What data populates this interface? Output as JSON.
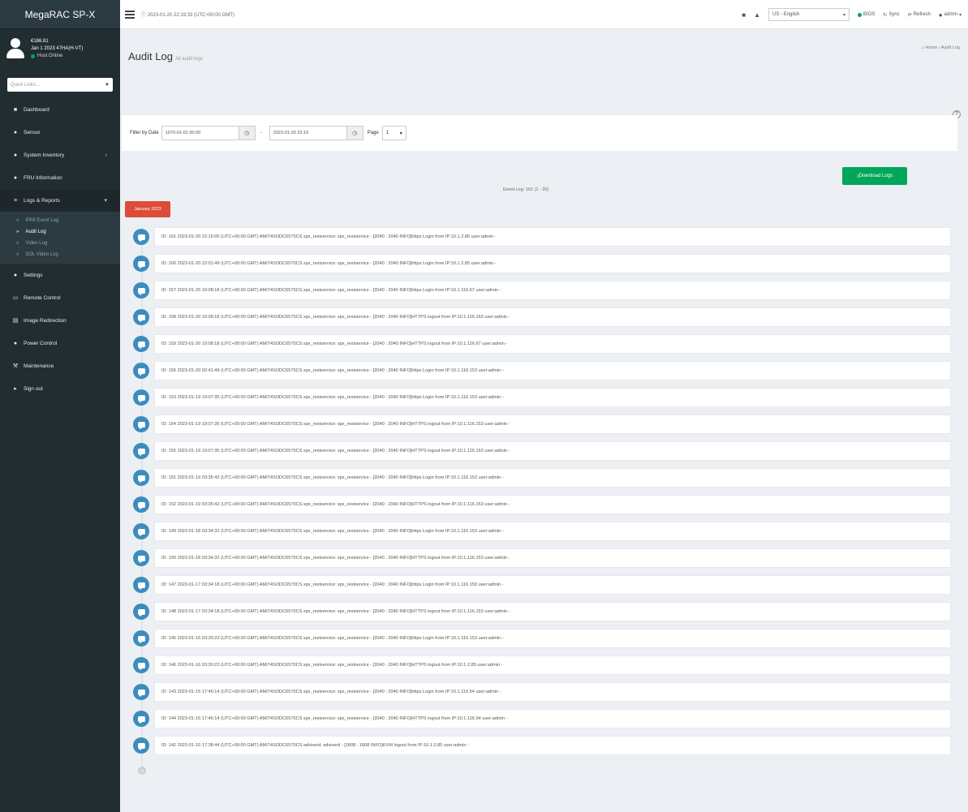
{
  "app": {
    "brand": "MegaRAC SP-X"
  },
  "user_panel": {
    "name": "€186.81",
    "detail": "Jan 1 2023 47HA(H-VT)",
    "status": "Host Online"
  },
  "sidebar": {
    "quick_links_placeholder": "Quick Links...",
    "items": [
      {
        "label": "Dashboard",
        "icon": "dashboard-icon",
        "glyph": "■"
      },
      {
        "label": "Sensor",
        "icon": "sensor-icon",
        "glyph": "●"
      },
      {
        "label": "System Inventory",
        "icon": "inventory-icon",
        "glyph": "●"
      },
      {
        "label": "FRU Information",
        "icon": "fru-icon",
        "glyph": "●"
      },
      {
        "label": "Logs & Reports",
        "icon": "chart-icon",
        "glyph": "≡"
      },
      {
        "label": "Settings",
        "icon": "settings-icon",
        "glyph": "●"
      },
      {
        "label": "Remote Control",
        "icon": "monitor-icon",
        "glyph": "▭"
      },
      {
        "label": "Image Redirection",
        "icon": "image-icon",
        "glyph": "▤"
      },
      {
        "label": "Power Control",
        "icon": "power-icon",
        "glyph": "●"
      },
      {
        "label": "Maintenance",
        "icon": "wrench-icon",
        "glyph": "⚒"
      },
      {
        "label": "Sign out",
        "icon": "signout-icon",
        "glyph": "▸"
      }
    ],
    "sub_items": [
      {
        "label": "IPMI Event Log"
      },
      {
        "label": "Audit Log"
      },
      {
        "label": "Video Log"
      },
      {
        "label": "SOL Video Log"
      }
    ]
  },
  "header": {
    "datetime": "ⓘ 2023-01-20 22:19:33 (UTC+00:00 GMT)",
    "language": "US - English",
    "links": {
      "bios": "BIOS",
      "sync": "Sync",
      "refresh": "Refresh",
      "user": "admin"
    }
  },
  "page": {
    "title": "Audit Log",
    "subtitle": "All audit logs",
    "breadcrumb_home": "Home",
    "breadcrumb_current": "Audit Log"
  },
  "filter": {
    "label": "Filter by Date",
    "start_date": "1970-01-01 00:00",
    "end_date": "2023-01-20 22:19",
    "page_label": "Page",
    "page_value": "1"
  },
  "logs": {
    "download_label": "Download Logs",
    "count_text": "Event Log: 161 (1 - 20)",
    "month_label": "January 2023",
    "entries": [
      "ID: 161 2023-01-20 22:15:05 (UTC+00:00 GMT)   AMI74SODC6570CS   spx_restservice: spx_restservice - [2040 : 2040 INFO]https Login from IP:10.1.2.85 user:admin -",
      "ID: 160 2023-01-20 22:01:49 (UTC+00:00 GMT)   AMI74SODC6570CS   spx_restservice: spx_restservice - [2040 : 2040 INFO]https Login from IP:10.1.2.85 user:admin -",
      "ID: 157 2023-01-20 10:08:18 (UTC+00:00 GMT)   AMI74SODC6570CS   spx_restservice: spx_restservice - [2040 : 2040 INFO]https Login from IP:10.1.116.67 user:admin -",
      "ID: 158 2023-01-20 10:08:18 (UTC+00:00 GMT)   AMI74SODC6570CS   spx_restservice: spx_restservice - [2040 : 2040 INFO]HTTPS logout from IP:10.1.116.153 user:admin -",
      "ID: 159 2023-01-20 10:08:18 (UTC+00:00 GMT)   AMI74SODC6570CS   spx_restservice: spx_restservice - [2040 : 2040 INFO]HTTPS logout from IP:10.1.116.67 user:admin -",
      "ID: 156 2023-01-20 02:41:49 (UTC+00:00 GMT)   AMI74SODC6570CS   spx_restservice: spx_restservice - [2040 : 2040 INFO]https Login from IP:10.1.116.153 user:admin -",
      "ID: 153 2023-01-19 19:07:35 (UTC+00:00 GMT)   AMI74SODC6570CS   spx_restservice: spx_restservice - [2040 : 2040 INFO]https Login from IP:10.1.116.153 user:admin -",
      "ID: 154 2023-01-19 19:07:35 (UTC+00:00 GMT)   AMI74SODC6570CS   spx_restservice: spx_restservice - [2040 : 2040 INFO]HTTPS logout from IP:10.1.116.153 user:admin -",
      "ID: 155 2023-01-19 19:07:35 (UTC+00:00 GMT)   AMI74SODC6570CS   spx_restservice: spx_restservice - [2040 : 2040 INFO]HTTPS logout from IP:10.1.116.153 user:admin -",
      "ID: 151 2023-01-19 03:35:42 (UTC+00:00 GMT)   AMI74SODC6570CS   spx_restservice: spx_restservice - [2040 : 2040 INFO]https Login from IP:10.1.116.153 user:admin -",
      "ID: 152 2023-01-19 03:35:42 (UTC+00:00 GMT)   AMI74SODC6570CS   spx_restservice: spx_restservice - [2040 : 2040 INFO]HTTPS logout from IP:10.1.116.153 user:admin -",
      "ID: 149 2023-01-18 03:34:32 (UTC+00:00 GMT)   AMI74SODC6570CS   spx_restservice: spx_restservice - [2040 : 2040 INFO]https Login from IP:10.1.116.153 user:admin -",
      "ID: 150 2023-01-18 03:34:32 (UTC+00:00 GMT)   AMI74SODC6570CS   spx_restservice: spx_restservice - [2040 : 2040 INFO]HTTPS logout from IP:10.1.116.153 user:admin -",
      "ID: 147 2023-01-17 03:34:18 (UTC+00:00 GMT)   AMI74SODC6570CS   spx_restservice: spx_restservice - [2040 : 2040 INFO]https Login from IP:10.1.116.153 user:admin -",
      "ID: 148 2023-01-17 03:34:18 (UTC+00:00 GMT)   AMI74SODC6570CS   spx_restservice: spx_restservice - [2040 : 2040 INFO]HTTPS logout from IP:10.1.116.153 user:admin -",
      "ID: 145 2023-01-16 03:30:23 (UTC+00:00 GMT)   AMI74SODC6570CS   spx_restservice: spx_restservice - [2040 : 2040 INFO]https Login from IP:10.1.116.153 user:admin -",
      "ID: 146 2023-01-16 03:30:23 (UTC+00:00 GMT)   AMI74SODC6570CS   spx_restservice: spx_restservice - [2040 : 2040 INFO]HTTPS logout from IP:10.1.2.85 user:admin -",
      "ID: 143 2023-01-15 17:46:14 (UTC+00:00 GMT)   AMI74SODC6570CS   spx_restservice: spx_restservice - [2040 : 2040 INFO]https Login from IP:10.1.116.54 user:admin -",
      "ID: 144 2023-01-15 17:46:14 (UTC+00:00 GMT)   AMI74SODC6570CS   spx_restservice: spx_restservice - [2040 : 2040 INFO]HTTPS logout from IP:10.1.116.54 user:admin -",
      "ID: 142 2023-01-15 17:38:44 (UTC+00:00 GMT)   AMI74SODC6570CS   adviserd: adviserd - [1808 : 1808 INFO]KVM logout from IP:10.1.2.85 user:admin -"
    ]
  },
  "colors": {
    "sidebar": "#222d32",
    "accent": "#3c8dbc",
    "success": "#00a65a",
    "danger": "#dd4b39"
  }
}
